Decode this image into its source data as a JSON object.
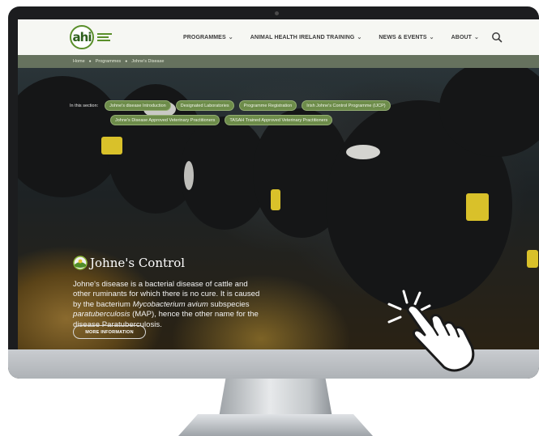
{
  "logo": {
    "text": "ahi"
  },
  "nav": {
    "items": [
      {
        "label": "PROGRAMMES"
      },
      {
        "label": "ANIMAL HEALTH IRELAND TRAINING"
      },
      {
        "label": "NEWS & EVENTS"
      },
      {
        "label": "ABOUT"
      }
    ],
    "search_icon": "search-icon"
  },
  "breadcrumb": [
    "Home",
    "Programmes",
    "Johne's Disease"
  ],
  "section": {
    "label": "In this section:",
    "row1": [
      "Johne's disease Introduction",
      "Designated Laboratories",
      "Programme Registration",
      "Irish Johne's Control Programme (IJCP)"
    ],
    "row2": [
      "Johne's Disease Approved Veterinary Practitioners",
      "TASAH Trained Approved Veterinary Practitioners"
    ]
  },
  "hero": {
    "title": "Johne's Control",
    "text_1": "Johne's disease is a bacterial disease of cattle and other ruminants for which there is no cure. It is caused by the bacterium ",
    "text_italic_1": "Mycobacterium avium",
    "text_2": " subspecies ",
    "text_italic_2": "paratuberculosis",
    "text_3": " (MAP), hence the other name for the disease Paratuberculosis.",
    "button": "MORE INFORMATION"
  },
  "colors": {
    "brand_green": "#5a8f2b",
    "pill_green": "#6d8c4a",
    "breadcrumb_bar": "#66725e",
    "navbar_bg": "#f6f7f3"
  }
}
